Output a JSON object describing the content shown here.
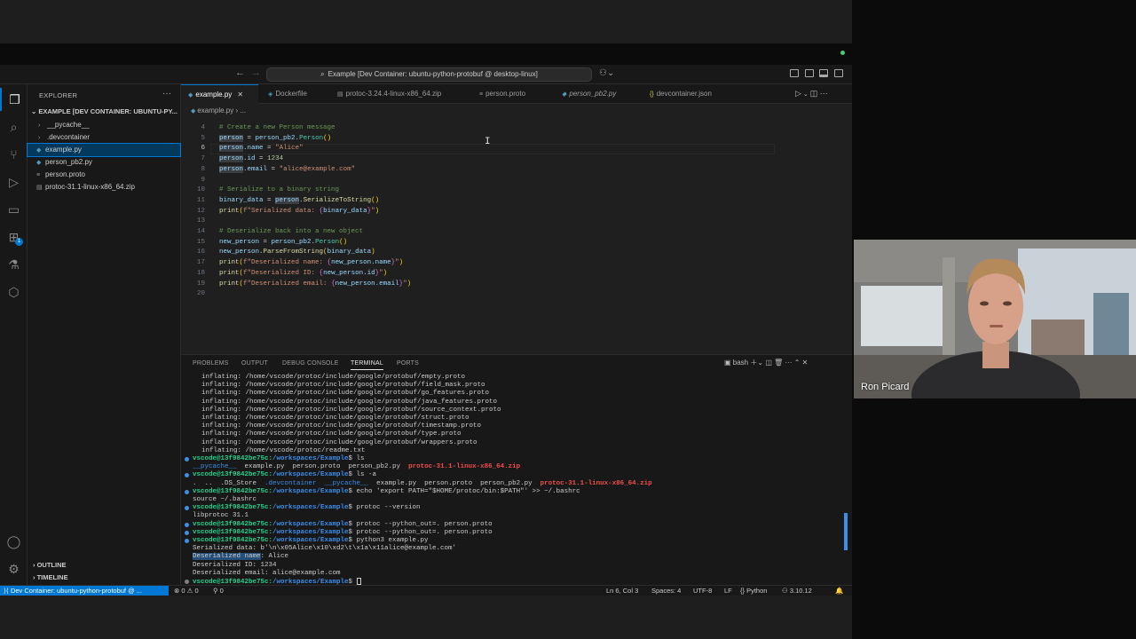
{
  "title_bar": {
    "command_center": "Example [Dev Container: ubuntu-python-protobuf @ desktop-linux]"
  },
  "sidebar": {
    "header": "EXPLORER",
    "folder": "EXAMPLE [DEV CONTAINER: UBUNTU-PY...",
    "items": [
      {
        "label": "__pycache__",
        "type": "folder"
      },
      {
        "label": ".devcontainer",
        "type": "folder"
      },
      {
        "label": "example.py",
        "type": "file"
      },
      {
        "label": "person_pb2.py",
        "type": "file"
      },
      {
        "label": "person.proto",
        "type": "file"
      },
      {
        "label": "protoc-31.1-linux-x86_64.zip",
        "type": "file"
      }
    ],
    "outline": "OUTLINE",
    "timeline": "TIMELINE"
  },
  "tabs": [
    {
      "label": "example.py",
      "active": true
    },
    {
      "label": "Dockerfile"
    },
    {
      "label": "protoc-3.24.4-linux-x86_64.zip"
    },
    {
      "label": "person.proto"
    },
    {
      "label": "person_pb2.py"
    },
    {
      "label": "devcontainer.json"
    }
  ],
  "breadcrumb": {
    "file": "example.py",
    "more": "..."
  },
  "editor": {
    "line_numbers": [
      "4",
      "5",
      "6",
      "7",
      "8",
      "9",
      "10",
      "11",
      "12",
      "13",
      "14",
      "15",
      "16",
      "17",
      "18",
      "19",
      "20"
    ],
    "current_line": "6"
  },
  "panel": {
    "tabs": [
      "PROBLEMS",
      "OUTPUT",
      "DEBUG CONSOLE",
      "TERMINAL",
      "PORTS"
    ],
    "active_tab": "TERMINAL",
    "shell": "bash",
    "terminal_lines": [
      "inflating: /home/vscode/protoc/include/google/protobuf/empty.proto",
      "inflating: /home/vscode/protoc/include/google/protobuf/field_mask.proto",
      "inflating: /home/vscode/protoc/include/google/protobuf/go_features.proto",
      "inflating: /home/vscode/protoc/include/google/protobuf/java_features.proto",
      "inflating: /home/vscode/protoc/include/google/protobuf/source_context.proto",
      "inflating: /home/vscode/protoc/include/google/protobuf/struct.proto",
      "inflating: /home/vscode/protoc/include/google/protobuf/timestamp.proto",
      "inflating: /home/vscode/protoc/include/google/protobuf/type.proto",
      "inflating: /home/vscode/protoc/include/google/protobuf/wrappers.proto",
      "inflating: /home/vscode/protoc/readme.txt"
    ],
    "prompt_user": "vscode@13f9842be75c:",
    "prompt_path": "/workspaces/Example",
    "commands": {
      "ls": "ls",
      "ls_a": "ls -a",
      "echo": "echo 'export PATH=\"$HOME/protoc/bin:$PATH\"' >> ~/.bashrc",
      "version": "protoc --version",
      "protoc1": "protoc --python_out=. person.proto",
      "protoc2": "protoc --python_out=. person.proto",
      "run": "python3 example.py"
    },
    "ls_out": {
      "pycache": "__pycache__",
      "files": "example.py  person.proto  person_pb2.py",
      "zip": "protoc-31.1-linux-x86_64.zip"
    },
    "ls_a_out": {
      "dots": ".  ..  .DS_Store",
      "dirs": ".devcontainer  __pycache__",
      "files": "example.py  person.proto  person_pb2.py",
      "zip": "protoc-31.1-linux-x86_64.zip"
    },
    "source_line": "source ~/.bashrc",
    "version_out": "libprotoc 31.1",
    "serialized": "Serialized data: b'\\n\\x05Alice\\x10\\xd2\\t\\x1a\\x11alice@example.com'",
    "deser_name_label": "Deserialized name",
    "deser_name_value": ": Alice",
    "deser_id": "Deserialized ID: 1234",
    "deser_email": "Deserialized email: alice@example.com"
  },
  "status_bar": {
    "remote": "Dev Container: ubuntu-python-protobuf @ ...",
    "errors": "0",
    "warnings": "0",
    "ports": "0",
    "position": "Ln 6, Col 3",
    "spaces": "Spaces: 4",
    "encoding": "UTF-8",
    "eol": "LF",
    "language": "Python",
    "python_version": "3.10.12"
  },
  "webcam": {
    "name": "Ron Picard"
  },
  "colors": {
    "accent": "#0078d4",
    "terminal_prompt": "#23d18b",
    "terminal_path": "#3b8eea",
    "terminal_zip": "#f14c4c"
  }
}
